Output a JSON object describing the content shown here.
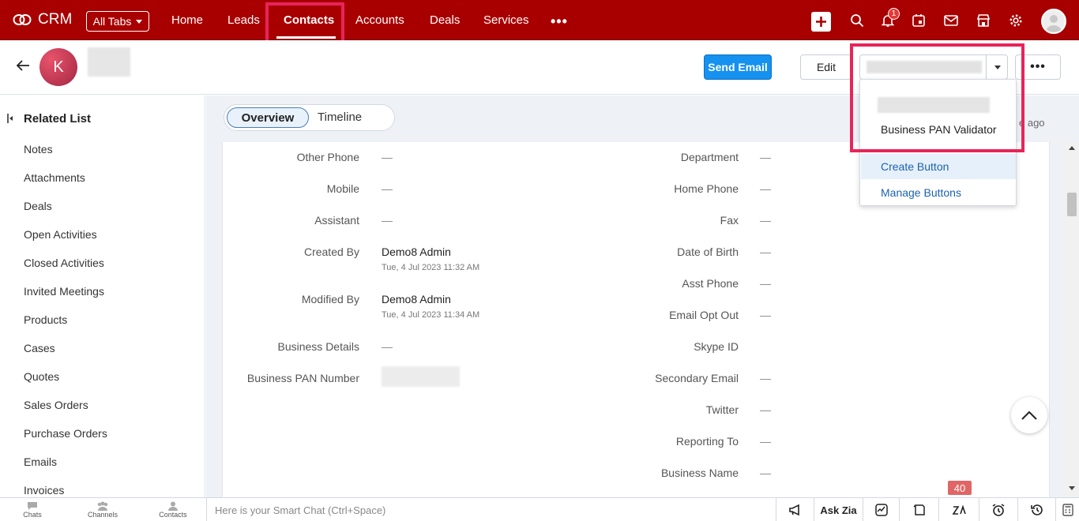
{
  "app": {
    "name": "CRM"
  },
  "nav": {
    "all_tabs": "All Tabs",
    "tabs": [
      "Home",
      "Leads",
      "Contacts",
      "Accounts",
      "Deals",
      "Services"
    ],
    "more": "•••",
    "notification_count": "1",
    "accent": "#a80000"
  },
  "record": {
    "avatar_letter": "K",
    "send_email": "Send Email",
    "edit": "Edit",
    "more": "•••"
  },
  "custom_dropdown": {
    "item_pan": "Business PAN Validator",
    "create": "Create Button",
    "manage": "Manage Buttons"
  },
  "sidebar": {
    "title": "Related List",
    "items": [
      "Notes",
      "Attachments",
      "Deals",
      "Open Activities",
      "Closed Activities",
      "Invited Meetings",
      "Products",
      "Cases",
      "Quotes",
      "Sales Orders",
      "Purchase Orders",
      "Emails",
      "Invoices"
    ]
  },
  "view_tabs": {
    "overview": "Overview",
    "timeline": "Timeline"
  },
  "modified_ago": "e ago",
  "fields_left": [
    {
      "label": "Other Phone",
      "value": "—"
    },
    {
      "label": "Mobile",
      "value": "—"
    },
    {
      "label": "Assistant",
      "value": "—"
    },
    {
      "label": "Created By",
      "value": "Demo8 Admin",
      "sub": "Tue, 4 Jul 2023 11:32 AM"
    },
    {
      "label": "Modified By",
      "value": "Demo8 Admin",
      "sub": "Tue, 4 Jul 2023 11:34 AM"
    },
    {
      "label": "Business Details",
      "value": "—"
    },
    {
      "label": "Business PAN Number",
      "value": ""
    }
  ],
  "fields_right": [
    {
      "label": "Department",
      "value": "—"
    },
    {
      "label": "Home Phone",
      "value": "—"
    },
    {
      "label": "Fax",
      "value": "—"
    },
    {
      "label": "Date of Birth",
      "value": "—"
    },
    {
      "label": "Asst Phone",
      "value": "—"
    },
    {
      "label": "Email Opt Out",
      "value": "—"
    },
    {
      "label": "Skype ID",
      "value": ""
    },
    {
      "label": "Secondary Email",
      "value": "—"
    },
    {
      "label": "Twitter",
      "value": "—"
    },
    {
      "label": "Reporting To",
      "value": "—"
    },
    {
      "label": "Business Name",
      "value": "—"
    }
  ],
  "bottom": {
    "chats": "Chats",
    "channels": "Channels",
    "contacts": "Contacts",
    "smart_chat_placeholder": "Here is your Smart Chat (Ctrl+Space)",
    "ask_zia": "Ask Zia",
    "count": "40"
  },
  "highlight_color": "#e8245a"
}
